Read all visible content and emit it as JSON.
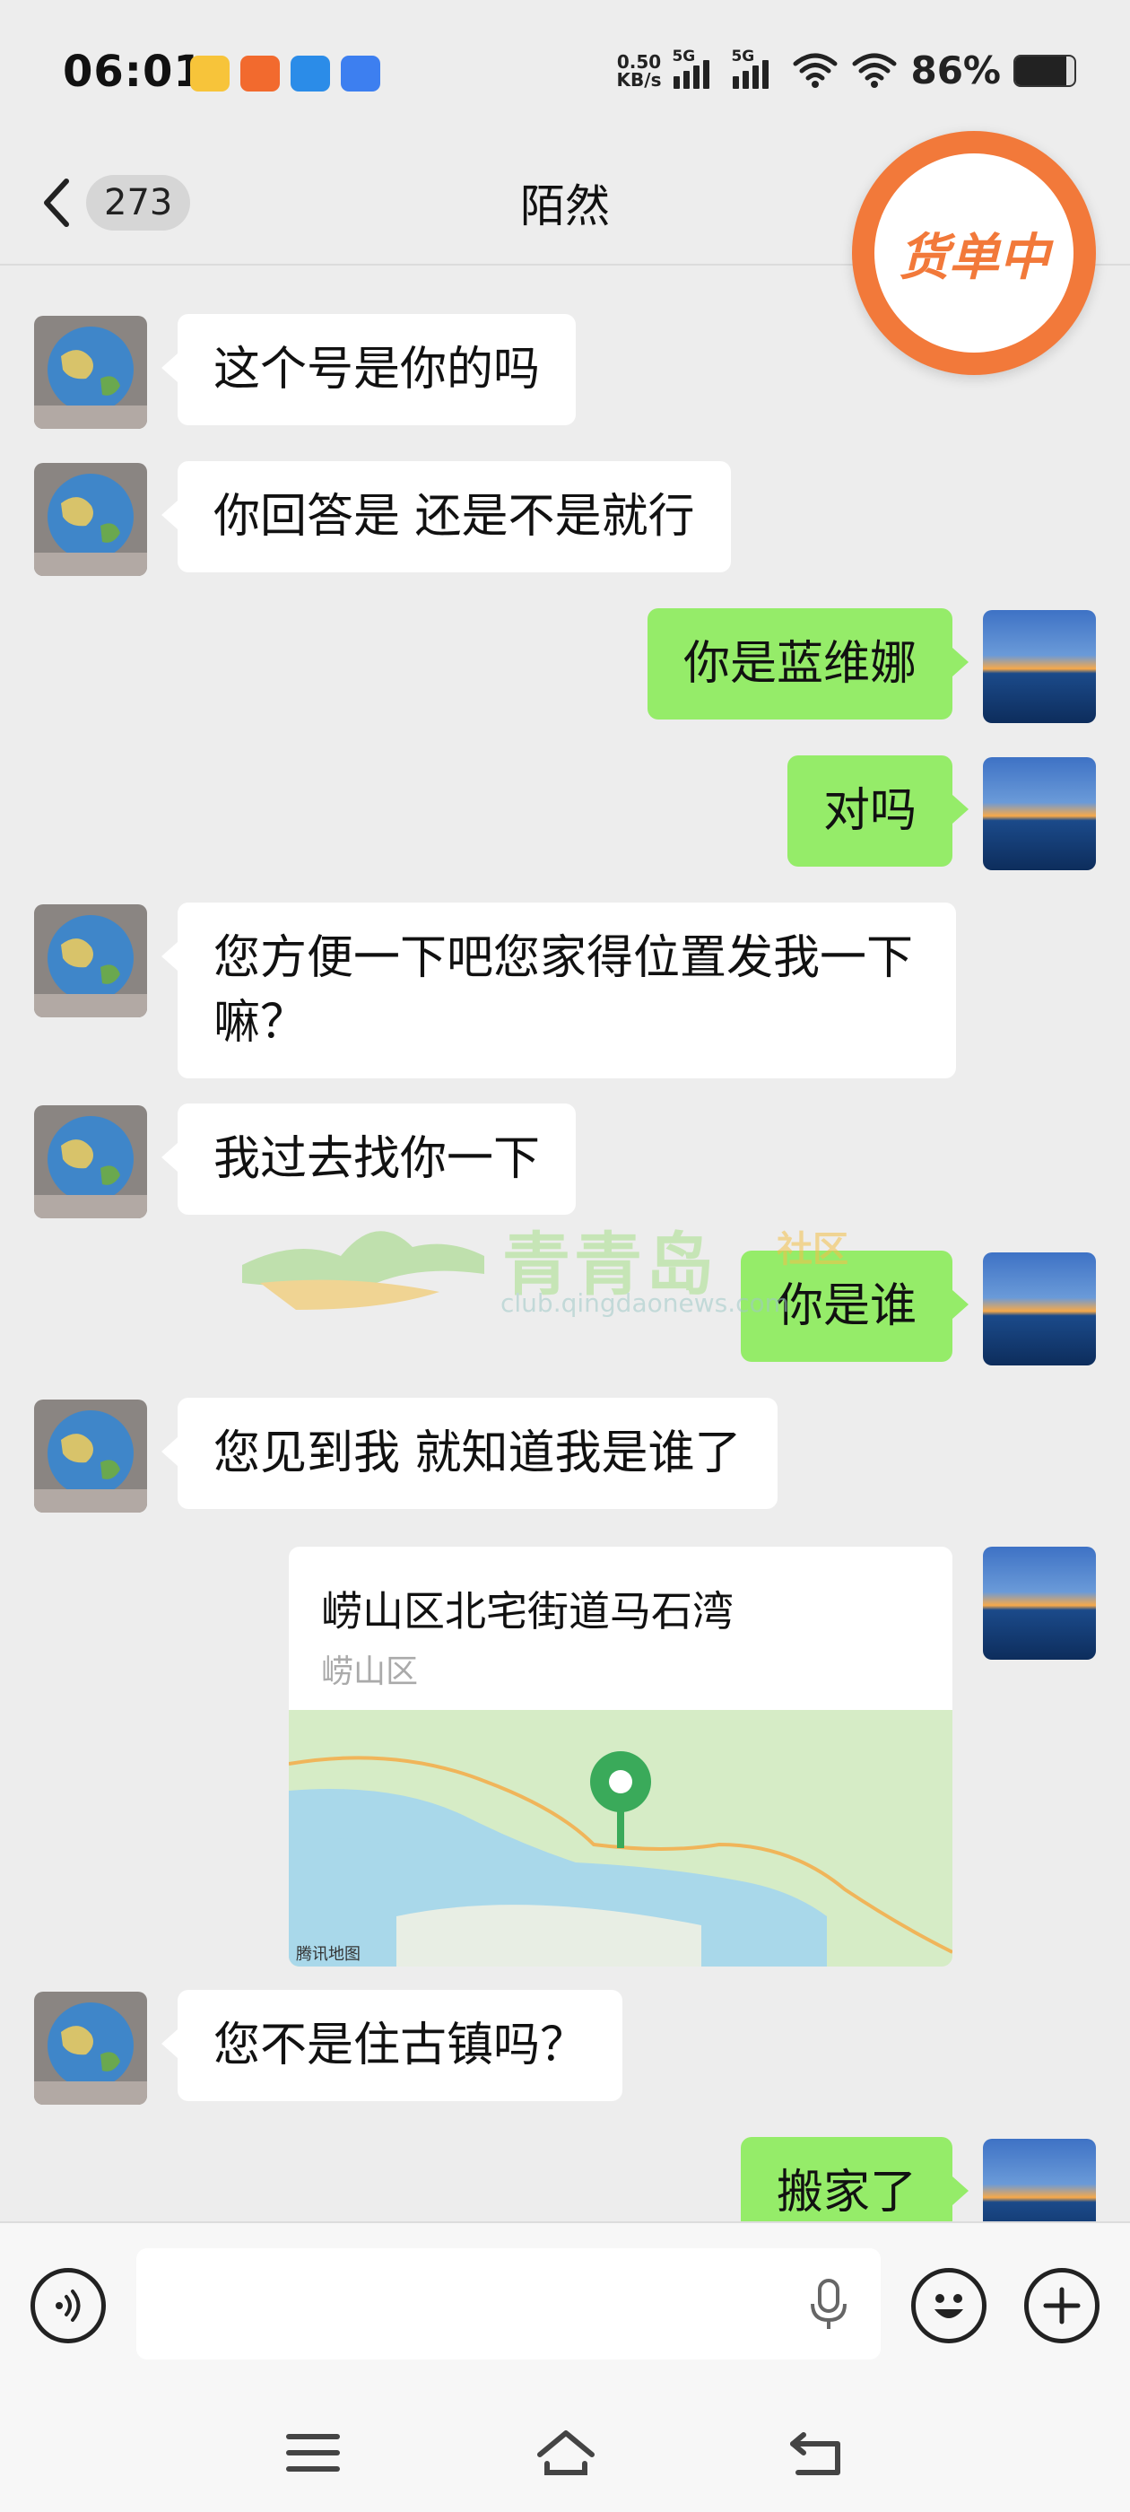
{
  "status_bar": {
    "time": "06:01",
    "net_speed_value": "0.50",
    "net_speed_unit": "KB/s",
    "sim1_tag": "5G",
    "sim2_tag": "5G",
    "battery_percent": "86%",
    "battery_level": 0.86
  },
  "header": {
    "back_count": "273",
    "title": "陌然",
    "floating_badge": "货单中"
  },
  "messages": [
    {
      "side": "in",
      "text": "这个号是你的吗"
    },
    {
      "side": "in",
      "text": "你回答是  还是不是就行"
    },
    {
      "side": "out",
      "text": "你是蓝维娜"
    },
    {
      "side": "out",
      "text": "对吗"
    },
    {
      "side": "in",
      "text": "您方便一下吧您家得位置发我一下嘛？"
    },
    {
      "side": "in",
      "text": "我过去找你一下"
    },
    {
      "side": "out",
      "text": "你是谁"
    },
    {
      "side": "in",
      "text": "您见到我   就知道我是谁了"
    },
    {
      "side": "out",
      "type": "location",
      "title": "崂山区北宅街道马石湾",
      "subtitle": "崂山区",
      "map_credit": "腾讯地图"
    },
    {
      "side": "in",
      "text": "您不是住古镇吗？"
    },
    {
      "side": "out",
      "text": "搬家了"
    }
  ],
  "watermark": {
    "title": "青青岛",
    "tag": "社区",
    "url": "club.qingdaonews.com"
  },
  "input": {
    "value": ""
  },
  "icons": {
    "voice": "voice-icon",
    "mic": "mic-icon",
    "emoji": "emoji-icon",
    "plus": "plus-icon",
    "menu": "menu-icon",
    "home": "home-icon",
    "back": "back-icon"
  },
  "colors": {
    "outgoing_bubble": "#95ec69",
    "incoming_bubble": "#ffffff",
    "background": "#ededed",
    "badge": "#f2793a"
  }
}
